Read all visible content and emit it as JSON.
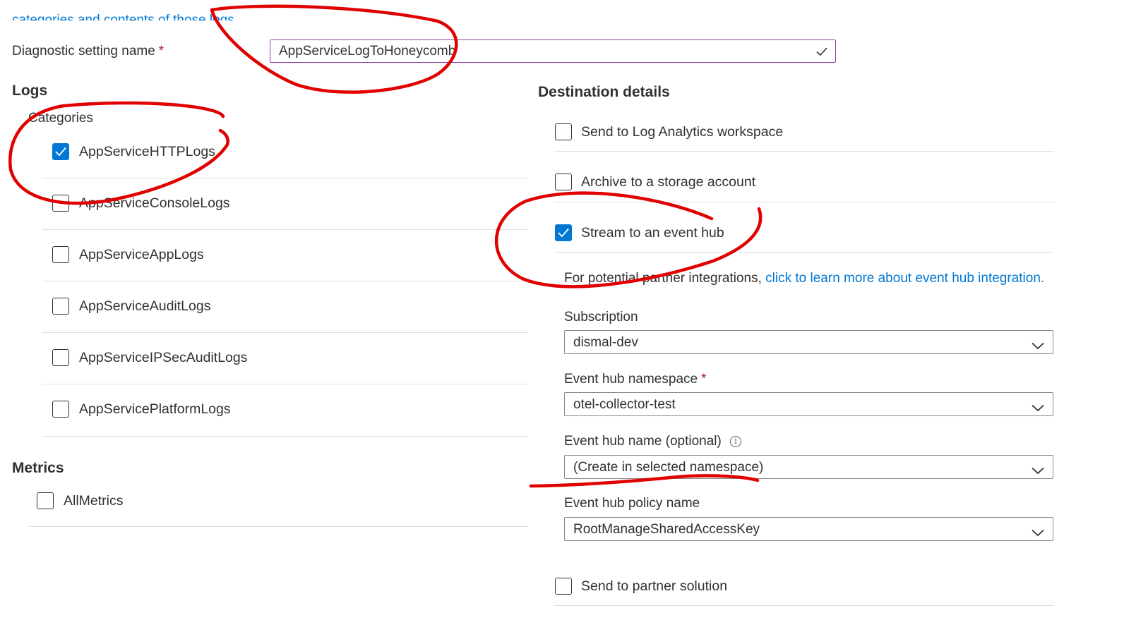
{
  "header": {
    "cut_off_link": "categories and contents of those logs"
  },
  "setting_name": {
    "label": "Diagnostic setting name",
    "required_marker": "*",
    "value": "AppServiceLogToHoneycomb",
    "valid_icon": "checkmark-icon"
  },
  "logs": {
    "title": "Logs",
    "categories_label": "Categories",
    "items": [
      {
        "label": "AppServiceHTTPLogs",
        "checked": true
      },
      {
        "label": "AppServiceConsoleLogs",
        "checked": false
      },
      {
        "label": "AppServiceAppLogs",
        "checked": false
      },
      {
        "label": "AppServiceAuditLogs",
        "checked": false
      },
      {
        "label": "AppServiceIPSecAuditLogs",
        "checked": false
      },
      {
        "label": "AppServicePlatformLogs",
        "checked": false
      }
    ]
  },
  "metrics": {
    "title": "Metrics",
    "items": [
      {
        "label": "AllMetrics",
        "checked": false
      }
    ]
  },
  "destination": {
    "title": "Destination details",
    "options": [
      {
        "label": "Send to Log Analytics workspace",
        "checked": false
      },
      {
        "label": "Archive to a storage account",
        "checked": false
      },
      {
        "label": "Stream to an event hub",
        "checked": true
      },
      {
        "label": "Send to partner solution",
        "checked": false
      }
    ],
    "partner_note": "For potential partner integrations,",
    "partner_link": "click to learn more about event hub integration.",
    "subscription": {
      "label": "Subscription",
      "value": "dismal-dev"
    },
    "namespace": {
      "label": "Event hub namespace",
      "required_marker": "*",
      "value": "otel-collector-test"
    },
    "hub_name": {
      "label": "Event hub name (optional)",
      "value": "(Create in selected namespace)",
      "info_icon": "i"
    },
    "policy": {
      "label": "Event hub policy name",
      "value": "RootManageSharedAccessKey"
    }
  },
  "colors": {
    "accent": "#0078d4",
    "annotation": "#e00000",
    "focus_border": "#8a3ea6",
    "required": "#a4262c"
  }
}
